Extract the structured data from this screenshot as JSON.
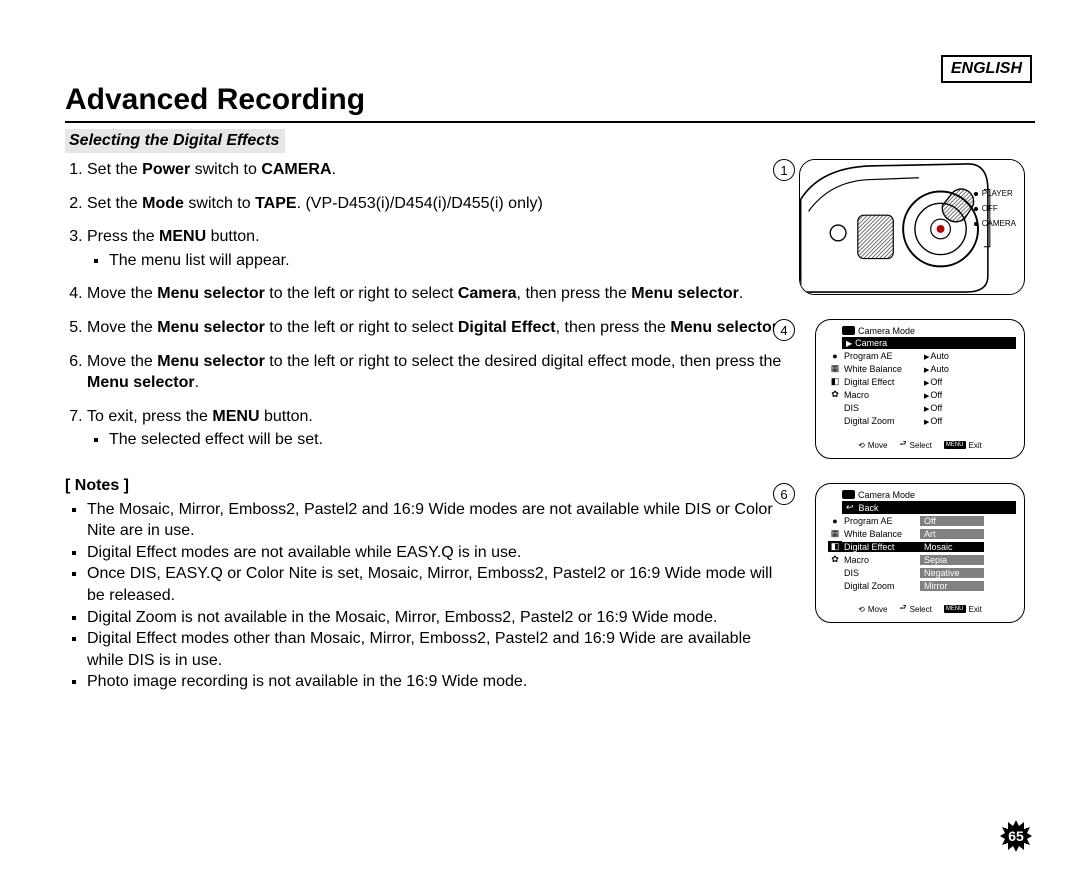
{
  "language_label": "ENGLISH",
  "title": "Advanced Recording",
  "section_heading": "Selecting the Digital Effects",
  "steps": [
    {
      "pre": "Set the ",
      "b1": "Power",
      "mid1": " switch to ",
      "b2": "CAMERA",
      "post": "."
    },
    {
      "pre": "Set the ",
      "b1": "Mode",
      "mid1": " switch to ",
      "b2": "TAPE",
      "post": ". (VP-D453(i)/D454(i)/D455(i) only)"
    },
    {
      "pre": "Press the ",
      "b1": "MENU",
      "post": " button.",
      "sub": "The menu list will appear."
    },
    {
      "pre": "Move the ",
      "b1": "Menu selector",
      "mid1": " to the left or right to select ",
      "b2": "Camera",
      "mid2": ", then press the ",
      "b3": "Menu selector",
      "post": "."
    },
    {
      "pre": "Move the ",
      "b1": "Menu selector",
      "mid1": " to the left or right to select ",
      "b2": "Digital Effect",
      "mid2": ", then press the ",
      "b3": "Menu selector",
      "post": "."
    },
    {
      "pre": "Move the ",
      "b1": "Menu selector",
      "mid1": " to the left or right to select the desired digital effect mode, then press the ",
      "b2": "Menu selector",
      "post": "."
    },
    {
      "pre": "To exit, press the ",
      "b1": "MENU",
      "post": " button.",
      "sub": "The selected effect will be set."
    }
  ],
  "notes_heading": "[ Notes ]",
  "notes": [
    "The Mosaic, Mirror, Emboss2, Pastel2 and 16:9 Wide modes are not available while DIS or Color Nite are in use.",
    "Digital Effect modes are not available while EASY.Q is in use.",
    "Once DIS, EASY.Q or Color Nite is set, Mosaic, Mirror, Emboss2, Pastel2 or 16:9 Wide mode will be released.",
    "Digital Zoom is not available in the Mosaic, Mirror, Emboss2, Pastel2 or 16:9 Wide mode.",
    "Digital Effect modes other than Mosaic, Mirror, Emboss2, Pastel2 and 16:9 Wide are available while DIS is in use.",
    "Photo image recording is not available in the 16:9 Wide mode."
  ],
  "fig1": {
    "label": "1",
    "switch_positions": [
      "PLAYER",
      "OFF",
      "CAMERA"
    ]
  },
  "fig4": {
    "label": "4",
    "mode": "Camera Mode",
    "submenu_marker": "▶",
    "submenu": "Camera",
    "rows": [
      {
        "icon": "●",
        "label": "Program AE",
        "value": "Auto"
      },
      {
        "icon": "▦",
        "label": "White Balance",
        "value": "Auto"
      },
      {
        "icon": "◧",
        "label": "Digital Effect",
        "value": "Off"
      },
      {
        "icon": "✿",
        "label": "Macro",
        "value": "Off"
      },
      {
        "icon": "",
        "label": "DIS",
        "value": "Off"
      },
      {
        "icon": "",
        "label": "Digital Zoom",
        "value": "Off"
      }
    ],
    "footer": {
      "move": "Move",
      "select": "Select",
      "menu": "MENU",
      "exit": "Exit"
    }
  },
  "fig6": {
    "label": "6",
    "mode": "Camera Mode",
    "submenu": "Back",
    "rows": [
      {
        "icon": "●",
        "label": "Program AE",
        "value": "Off",
        "val_hl": true
      },
      {
        "icon": "▦",
        "label": "White Balance",
        "value": "Art",
        "val_hl": true,
        "check": true
      },
      {
        "icon": "◧",
        "label": "Digital Effect",
        "value": "Mosaic",
        "row_sel": true,
        "val_sel": true
      },
      {
        "icon": "✿",
        "label": "Macro",
        "value": "Sepia",
        "val_hl": true
      },
      {
        "icon": "",
        "label": "DIS",
        "value": "Negative",
        "val_hl": true
      },
      {
        "icon": "",
        "label": "Digital Zoom",
        "value": "Mirror",
        "val_hl": true
      }
    ],
    "footer": {
      "move": "Move",
      "select": "Select",
      "menu": "MENU",
      "exit": "Exit"
    }
  },
  "page_number": "65"
}
